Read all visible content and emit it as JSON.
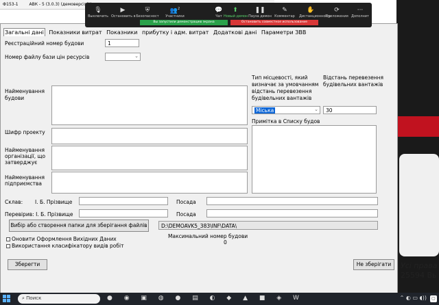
{
  "window": {
    "title_left": "Ф153-1",
    "title": "АВК - 5 (3.0.3) (демоверсія)Кошто..."
  },
  "zoom": {
    "buttons": [
      {
        "label": "Выключить",
        "icon": "mic-icon"
      },
      {
        "label": "Остановить в",
        "icon": "video-icon"
      },
      {
        "label": "Безопасност",
        "icon": "shield-icon"
      },
      {
        "label": "Участники",
        "icon": "people-icon"
      },
      {
        "label": "Чат",
        "icon": "chat-icon"
      },
      {
        "label": "Новый демон",
        "icon": "share-icon"
      },
      {
        "label": "Пауза демон",
        "icon": "pause-icon"
      },
      {
        "label": "Комментар",
        "icon": "pen-icon"
      },
      {
        "label": "Дистанционное у",
        "icon": "remote-icon"
      },
      {
        "label": "Приложения",
        "icon": "apps-icon"
      },
      {
        "label": "Дополнит",
        "icon": "more-icon"
      }
    ],
    "participants_count": "2",
    "sharing_notice": "Вы запустили демонстрацию экрана",
    "stop_label": "Остановить совместное использование"
  },
  "tabs": [
    "Загальні дані",
    "Показники витрат",
    "Показники",
    "прибутку і адм. витрат",
    "Додаткові дані",
    "Параметри ЗВВ"
  ],
  "form": {
    "reg_label": "Реєстраційний номер будови",
    "reg_value": "1",
    "price_db_label": "Номер файлу бази цін ресурсів",
    "price_db_value": "",
    "name_label": "Найменування будови",
    "code_label": "Шифр проекту",
    "org_label": "Найменування організації, що затверджує",
    "enterprise_label": "Найменування підприємства",
    "locality_label": "Тип місцевості, який визначає за умовчанням відстань перевезення будівельних вантажів",
    "distance_label": "Відстань перевезення будівельних вантажів",
    "locality_value": "Міська",
    "distance_value": "30",
    "note_label": "Примітка в Списку будов",
    "composed_label": "Склав:",
    "composed_name_label": "І. Б. Прізвище",
    "position_label": "Посада",
    "checked_label": "Перевірив: І. Б. Прізвище",
    "checked_position_label": "Посада",
    "folder_button": "Вибір або створення папки для зберігання файлів",
    "folder_path": "D:\\DEMOAVK5_383\\INF\\DATA\\",
    "max_number_label": "Максимальний номер будови",
    "max_number_value": "0",
    "update_checkbox": "Оновити Оформлення  Вихідних Даних",
    "classifier_checkbox": "Використання  класифікатору видів робіт",
    "save_button": "Зберегти",
    "nosave_button": "Не зберігати"
  },
  "desktop": {
    "line1": "Усі права",
    "line2": "25594 Вь"
  },
  "taskbar": {
    "search_placeholder": "Поиск"
  }
}
